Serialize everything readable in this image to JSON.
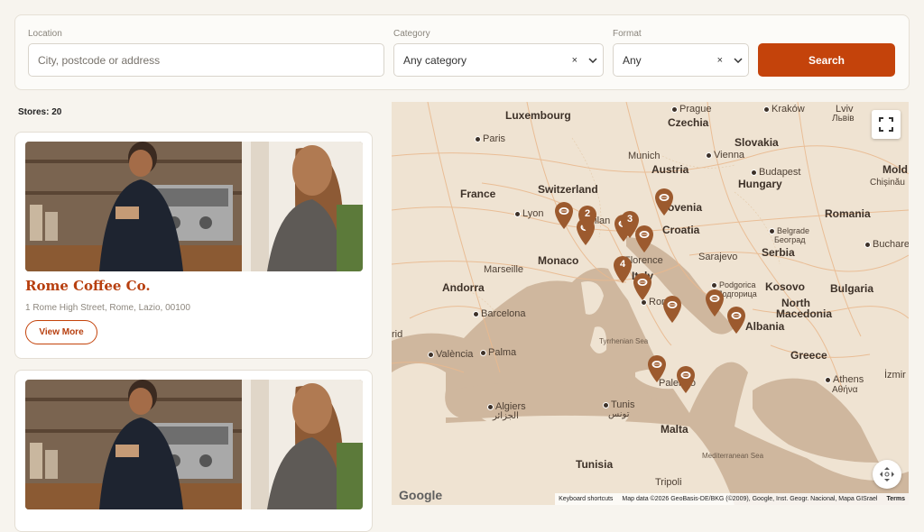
{
  "filters": {
    "location": {
      "label": "Location",
      "placeholder": "City, postcode or address",
      "value": ""
    },
    "category": {
      "label": "Category",
      "value": "Any category",
      "clear": "×"
    },
    "format": {
      "label": "Format",
      "value": "Any",
      "clear": "×"
    },
    "search_label": "Search"
  },
  "stores_count": "Stores: 20",
  "cards": [
    {
      "title": "Rome Coffee Co.",
      "address": "1 Rome High Street, Rome, Lazio, 00100",
      "button": "View More"
    },
    {
      "title": "",
      "address": "",
      "button": ""
    }
  ],
  "map": {
    "labels": [
      {
        "id": "luxembourg",
        "text": "Luxembourg"
      },
      {
        "id": "prague",
        "text": "Prague"
      },
      {
        "id": "czechia",
        "text": "Czechia"
      },
      {
        "id": "krakow",
        "text": "Kraków"
      },
      {
        "id": "lviv",
        "text": "Lviv"
      },
      {
        "id": "lviv-cyr",
        "text": "Львів"
      },
      {
        "id": "paris",
        "text": "Paris"
      },
      {
        "id": "slovakia",
        "text": "Slovakia"
      },
      {
        "id": "munich",
        "text": "Munich"
      },
      {
        "id": "vienna",
        "text": "Vienna"
      },
      {
        "id": "austria",
        "text": "Austria"
      },
      {
        "id": "budapest",
        "text": "Budapest"
      },
      {
        "id": "hungary",
        "text": "Hungary"
      },
      {
        "id": "moldova",
        "text": "Mold"
      },
      {
        "id": "chisinau",
        "text": "Chișinău"
      },
      {
        "id": "france",
        "text": "France"
      },
      {
        "id": "switzerland",
        "text": "Switzerland"
      },
      {
        "id": "lyon",
        "text": "Lyon"
      },
      {
        "id": "slovenia",
        "text": "ovenia"
      },
      {
        "id": "croatia",
        "text": "Croatia"
      },
      {
        "id": "romania",
        "text": "Romania"
      },
      {
        "id": "milan",
        "text": "Milan"
      },
      {
        "id": "belgrade",
        "text": "Belgrade"
      },
      {
        "id": "belgrade-cyr",
        "text": "Београд"
      },
      {
        "id": "bucharest",
        "text": "Buchares"
      },
      {
        "id": "sarajevo",
        "text": "Sarajevo"
      },
      {
        "id": "serbia",
        "text": "Serbia"
      },
      {
        "id": "monaco",
        "text": "Monaco"
      },
      {
        "id": "marseille",
        "text": "Marseille"
      },
      {
        "id": "florence",
        "text": "Florence"
      },
      {
        "id": "italy",
        "text": "Italy"
      },
      {
        "id": "andorra",
        "text": "Andorra"
      },
      {
        "id": "podgorica",
        "text": "Podgorica"
      },
      {
        "id": "podgorica-cyr",
        "text": "Подгорица"
      },
      {
        "id": "kosovo",
        "text": "Kosovo"
      },
      {
        "id": "bulgaria",
        "text": "Bulgaria"
      },
      {
        "id": "north-macedonia-1",
        "text": "North"
      },
      {
        "id": "north-macedonia-2",
        "text": "Macedonia"
      },
      {
        "id": "barcelona",
        "text": "Barcelona"
      },
      {
        "id": "rome",
        "text": "Rome"
      },
      {
        "id": "albania",
        "text": "Albania"
      },
      {
        "id": "madrid",
        "text": "rid"
      },
      {
        "id": "tyrrhenian",
        "text": "Tyrrhenian Sea"
      },
      {
        "id": "valencia",
        "text": "València"
      },
      {
        "id": "palma",
        "text": "Palma"
      },
      {
        "id": "greece",
        "text": "Greece"
      },
      {
        "id": "izmir",
        "text": "İzmir"
      },
      {
        "id": "palermo",
        "text": "Palermo"
      },
      {
        "id": "athens",
        "text": "Athens"
      },
      {
        "id": "athens-gr",
        "text": "Αθήνα"
      },
      {
        "id": "algiers",
        "text": "Algiers"
      },
      {
        "id": "algiers-ar",
        "text": "الجزائر"
      },
      {
        "id": "tunis",
        "text": "Tunis"
      },
      {
        "id": "tunis-ar",
        "text": "تونس"
      },
      {
        "id": "malta",
        "text": "Malta"
      },
      {
        "id": "med-sea",
        "text": "Mediterranean Sea"
      },
      {
        "id": "tunisia",
        "text": "Tunisia"
      },
      {
        "id": "tripoli",
        "text": "Tripoli"
      }
    ],
    "clusters": [
      {
        "id": "cluster-2",
        "count": "2"
      },
      {
        "id": "cluster-3",
        "count": "3"
      },
      {
        "id": "cluster-4",
        "count": "4"
      }
    ],
    "google": "Google",
    "keyboard_shortcuts": "Keyboard shortcuts",
    "map_data": "Map data ©2026 GeoBasis-DE/BKG (©2009), Google, Inst. Geogr. Nacional, Mapa GISrael",
    "terms": "Terms"
  },
  "colors": {
    "accent": "#c4430b",
    "accent_text": "#b73f0f",
    "pin": "#9c5a2e",
    "land": "#efe3d2",
    "sea": "#cfb79e"
  }
}
